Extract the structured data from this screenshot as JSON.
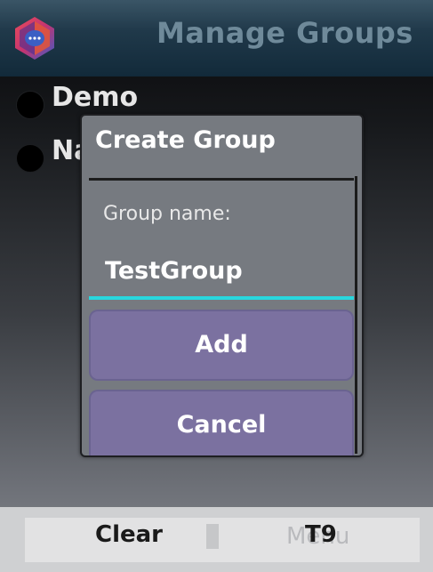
{
  "header": {
    "title": "Manage Groups",
    "logo_icon": "chat-app-logo-icon"
  },
  "groups": [
    {
      "label": "Demo",
      "selected": false
    },
    {
      "label": "Na",
      "selected": false
    }
  ],
  "dialog": {
    "title": "Create Group",
    "field_label": "Group name:",
    "field_value": "TestGroup",
    "add_label": "Add",
    "cancel_label": "Cancel"
  },
  "softkeys": {
    "left": "Clear",
    "right_ghost": "Menu",
    "right": "T9"
  },
  "colors": {
    "accent_underline": "#28d7de",
    "button_bg": "#7b71a0",
    "dialog_bg": "#767a80",
    "header_bg": "#20394a"
  }
}
